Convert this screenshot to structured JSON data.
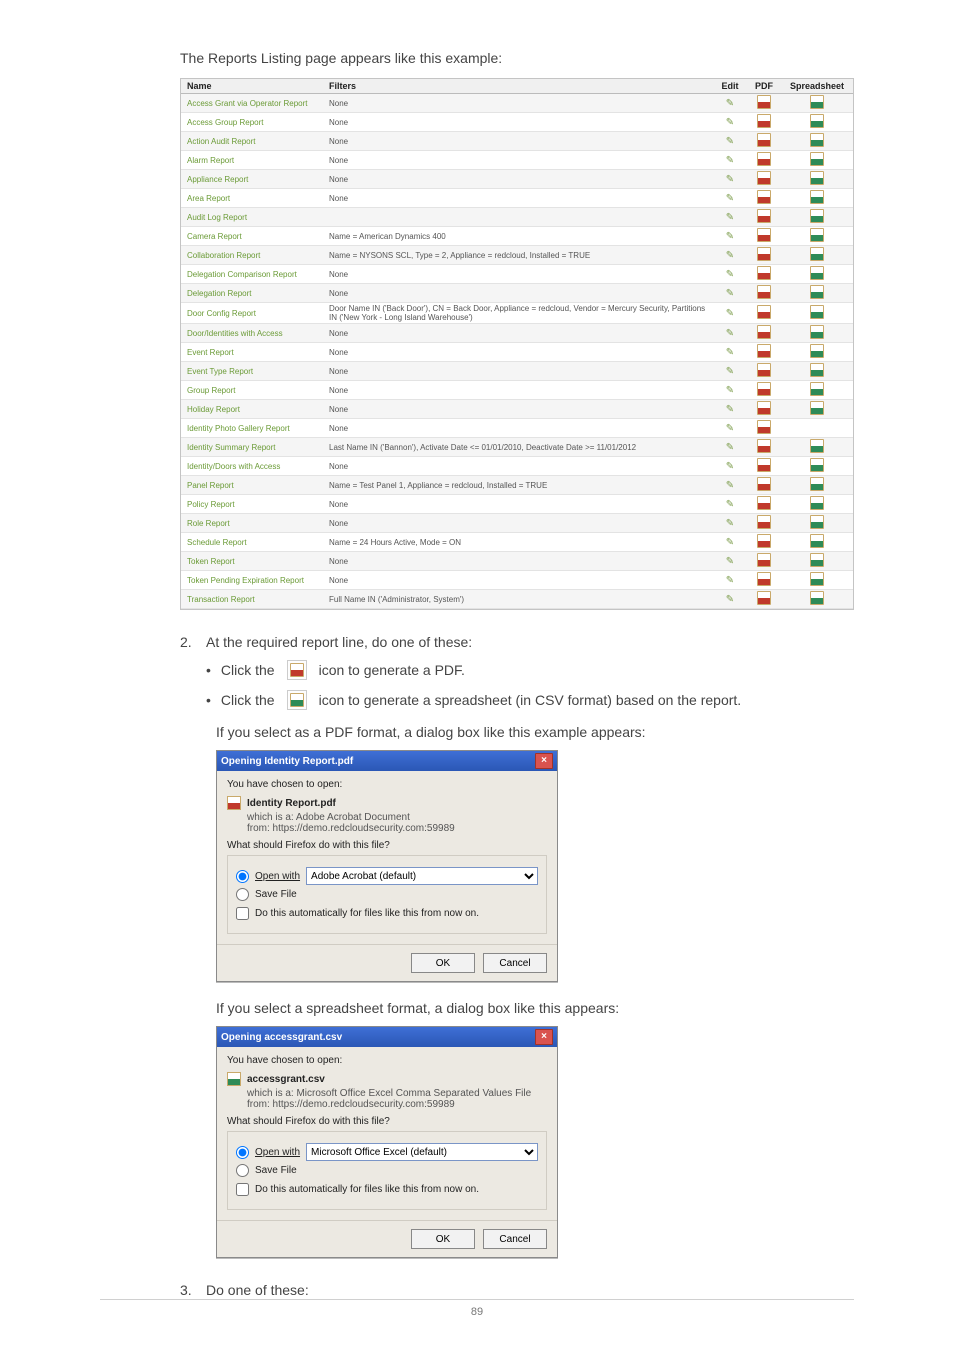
{
  "intro": "The Reports Listing page appears like this example:",
  "table": {
    "headers": {
      "name": "Name",
      "filters": "Filters",
      "edit": "Edit",
      "pdf": "PDF",
      "spreadsheet": "Spreadsheet"
    },
    "rows": [
      {
        "name": "Access Grant via Operator Report",
        "filters": "None",
        "pdf": true,
        "xls": true
      },
      {
        "name": "Access Group Report",
        "filters": "None",
        "pdf": true,
        "xls": true
      },
      {
        "name": "Action Audit Report",
        "filters": "None",
        "pdf": true,
        "xls": true
      },
      {
        "name": "Alarm Report",
        "filters": "None",
        "pdf": true,
        "xls": true
      },
      {
        "name": "Appliance Report",
        "filters": "None",
        "pdf": true,
        "xls": true
      },
      {
        "name": "Area Report",
        "filters": "None",
        "pdf": true,
        "xls": true
      },
      {
        "name": "Audit Log Report",
        "filters": "",
        "pdf": true,
        "xls": true
      },
      {
        "name": "Camera Report",
        "filters": "Name = American Dynamics 400",
        "pdf": true,
        "xls": true
      },
      {
        "name": "Collaboration Report",
        "filters": "Name = NYSONS SCL, Type = 2, Appliance = redcloud, Installed = TRUE",
        "pdf": true,
        "xls": true
      },
      {
        "name": "Delegation Comparison Report",
        "filters": "None",
        "pdf": true,
        "xls": true
      },
      {
        "name": "Delegation Report",
        "filters": "None",
        "pdf": true,
        "xls": true
      },
      {
        "name": "Door Config Report",
        "filters": "Door Name IN ('Back Door'), CN = Back Door, Appliance = redcloud, Vendor = Mercury Security, Partitions IN ('New York - Long Island Warehouse')",
        "pdf": true,
        "xls": true
      },
      {
        "name": "Door/Identities with Access",
        "filters": "None",
        "pdf": true,
        "xls": true
      },
      {
        "name": "Event Report",
        "filters": "None",
        "pdf": true,
        "xls": true
      },
      {
        "name": "Event Type Report",
        "filters": "None",
        "pdf": true,
        "xls": true
      },
      {
        "name": "Group Report",
        "filters": "None",
        "pdf": true,
        "xls": true
      },
      {
        "name": "Holiday Report",
        "filters": "None",
        "pdf": true,
        "xls": true
      },
      {
        "name": "Identity Photo Gallery Report",
        "filters": "None",
        "pdf": true,
        "xls": false
      },
      {
        "name": "Identity Summary Report",
        "filters": "Last Name IN ('Bannon'), Activate Date <= 01/01/2010, Deactivate Date >= 11/01/2012",
        "pdf": true,
        "xls": true
      },
      {
        "name": "Identity/Doors with Access",
        "filters": "None",
        "pdf": true,
        "xls": true
      },
      {
        "name": "Panel Report",
        "filters": "Name = Test Panel 1, Appliance = redcloud, Installed = TRUE",
        "pdf": true,
        "xls": true
      },
      {
        "name": "Policy Report",
        "filters": "None",
        "pdf": true,
        "xls": true
      },
      {
        "name": "Role Report",
        "filters": "None",
        "pdf": true,
        "xls": true
      },
      {
        "name": "Schedule Report",
        "filters": "Name = 24 Hours Active, Mode = ON",
        "pdf": true,
        "xls": true
      },
      {
        "name": "Token Report",
        "filters": "None",
        "pdf": true,
        "xls": true
      },
      {
        "name": "Token Pending Expiration Report",
        "filters": "None",
        "pdf": true,
        "xls": true
      },
      {
        "name": "Transaction Report",
        "filters": "Full Name IN ('Administrator, System')",
        "pdf": true,
        "xls": true
      }
    ]
  },
  "step2": {
    "num": "2.",
    "text": "At the required report line, do one of these:",
    "bullets": {
      "b1a": "Click the",
      "b1b": "icon to generate a PDF.",
      "b2a": "Click the",
      "b2b": "icon to generate a spreadsheet (in CSV format) based on the report."
    }
  },
  "note_pdf": "If you select as a PDF format, a dialog box like this example appears:",
  "dialog_pdf": {
    "title": "Opening Identity Report.pdf",
    "chosen": "You have chosen to open:",
    "filename": "Identity Report.pdf",
    "which": "which is a:  Adobe Acrobat Document",
    "from": "from:  https://demo.redcloudsecurity.com:59989",
    "ask": "What should Firefox do with this file?",
    "open_label": "Open with",
    "open_sel": "Adobe Acrobat  (default)",
    "save_label": "Save File",
    "auto": "Do this automatically for files like this from now on.",
    "ok": "OK",
    "cancel": "Cancel"
  },
  "note_csv": "If you select a spreadsheet format, a dialog box like this appears:",
  "dialog_csv": {
    "title": "Opening accessgrant.csv",
    "chosen": "You have chosen to open:",
    "filename": "accessgrant.csv",
    "which": "which is a:  Microsoft Office Excel Comma Separated Values File",
    "from": "from:  https://demo.redcloudsecurity.com:59989",
    "ask": "What should Firefox do with this file?",
    "open_label": "Open with",
    "open_sel": "Microsoft Office Excel (default)",
    "save_label": "Save File",
    "auto": "Do this automatically for files like this from now on.",
    "ok": "OK",
    "cancel": "Cancel"
  },
  "step3": {
    "num": "3.",
    "text": "Do one of these:"
  },
  "page_number": "89"
}
